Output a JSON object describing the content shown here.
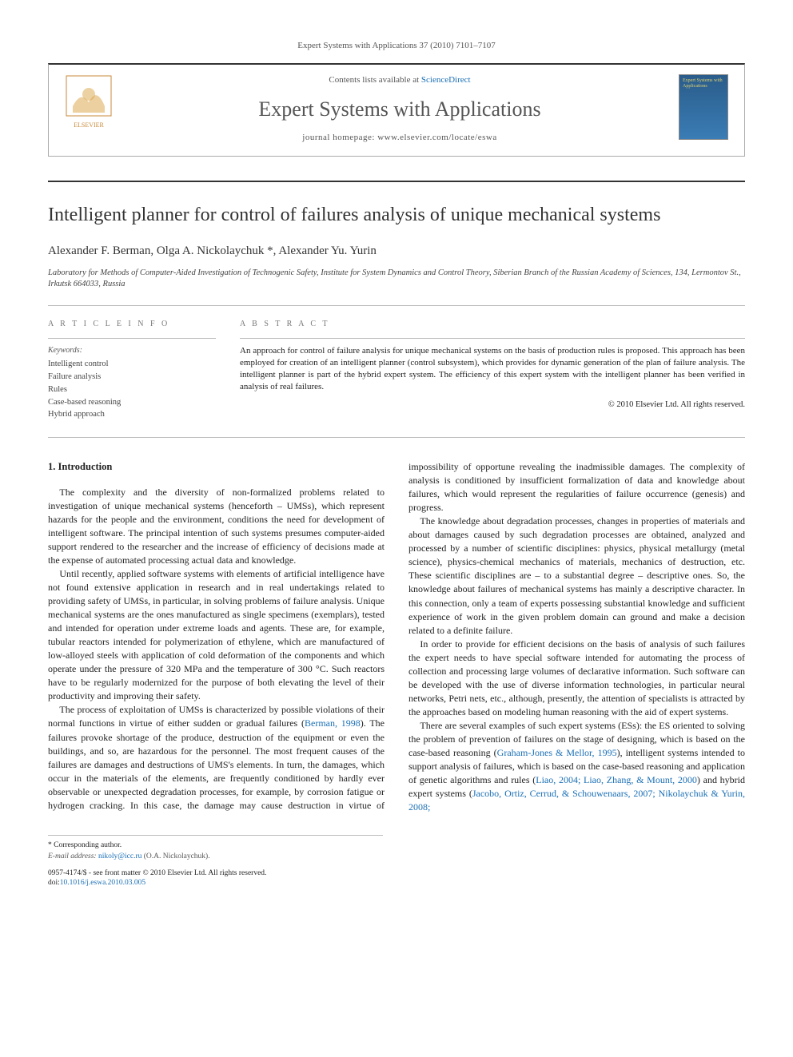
{
  "citation": "Expert Systems with Applications 37 (2010) 7101–7107",
  "header": {
    "contents_prefix": "Contents lists available at ",
    "contents_link": "ScienceDirect",
    "journal": "Expert Systems with Applications",
    "homepage_prefix": "journal homepage: ",
    "homepage": "www.elsevier.com/locate/eswa",
    "cover_title": "Expert Systems with Applications",
    "elsevier_label": "ELSEVIER"
  },
  "article": {
    "title": "Intelligent planner for control of failures analysis of unique mechanical systems",
    "authors": "Alexander F. Berman, Olga A. Nickolaychuk *, Alexander Yu. Yurin",
    "affiliation": "Laboratory for Methods of Computer-Aided Investigation of Technogenic Safety, Institute for System Dynamics and Control Theory, Siberian Branch of the Russian Academy of Sciences, 134, Lermontov St., Irkutsk 664033, Russia"
  },
  "info": {
    "heading": "A R T I C L E   I N F O",
    "keywords_label": "Keywords:",
    "keywords": [
      "Intelligent control",
      "Failure analysis",
      "Rules",
      "Case-based reasoning",
      "Hybrid approach"
    ]
  },
  "abstract": {
    "heading": "A B S T R A C T",
    "text": "An approach for control of failure analysis for unique mechanical systems on the basis of production rules is proposed. This approach has been employed for creation of an intelligent planner (control subsystem), which provides for dynamic generation of the plan of failure analysis. The intelligent planner is part of the hybrid expert system. The efficiency of this expert system with the intelligent planner has been verified in analysis of real failures.",
    "copyright": "© 2010 Elsevier Ltd. All rights reserved."
  },
  "body": {
    "section1_heading": "1. Introduction",
    "p1": "The complexity and the diversity of non-formalized problems related to investigation of unique mechanical systems (henceforth – UMSs), which represent hazards for the people and the environment, conditions the need for development of intelligent software. The principal intention of such systems presumes computer-aided support rendered to the researcher and the increase of efficiency of decisions made at the expense of automated processing actual data and knowledge.",
    "p2": "Until recently, applied software systems with elements of artificial intelligence have not found extensive application in research and in real undertakings related to providing safety of UMSs, in particular, in solving problems of failure analysis. Unique mechanical systems are the ones manufactured as single specimens (exemplars), tested and intended for operation under extreme loads and agents. These are, for example, tubular reactors intended for polymerization of ethylene, which are manufactured of low-alloyed steels with application of cold deformation of the components and which operate under the pressure of 320 MPa and the temperature of 300 °C. Such reactors have to be regularly modernized for the purpose of both elevating the level of their productivity and improving their safety.",
    "p3a": "The process of exploitation of UMSs is characterized by possible violations of their normal functions in virtue of either sudden or gradual failures (",
    "p3_cite": "Berman, 1998",
    "p3b": "). The failures provoke shortage of the produce, destruction of the equipment or even the buildings, and so, are hazardous for the personnel. The most frequent causes of the failures are damages and destructions of UMS's elements. In turn, the damages, which occur in the materials of the elements, are frequently conditioned by hardly ever observable or unexpected degradation processes, for example, by corrosion fatigue or hydrogen cracking. In this case, the damage may cause destruction in virtue of impossibility of opportune revealing the inadmissible damages. The complexity of analysis is conditioned by insufficient formalization of data and knowledge about failures, which would represent the regularities of failure occurrence (genesis) and progress.",
    "p4": "The knowledge about degradation processes, changes in properties of materials and about damages caused by such degradation processes are obtained, analyzed and processed by a number of scientific disciplines: physics, physical metallurgy (metal science), physics-chemical mechanics of materials, mechanics of destruction, etc. These scientific disciplines are – to a substantial degree – descriptive ones. So, the knowledge about failures of mechanical systems has mainly a descriptive character. In this connection, only a team of experts possessing substantial knowledge and sufficient experience of work in the given problem domain can ground and make a decision related to a definite failure.",
    "p5": "In order to provide for efficient decisions on the basis of analysis of such failures the expert needs to have special software intended for automating the process of collection and processing large volumes of declarative information. Such software can be developed with the use of diverse information technologies, in particular neural networks, Petri nets, etc., although, presently, the attention of specialists is attracted by the approaches based on modeling human reasoning with the aid of expert systems.",
    "p6a": "There are several examples of such expert systems (ESs): the ES oriented to solving the problem of prevention of failures on the stage of designing, which is based on the case-based reasoning (",
    "p6_cite1": "Graham-Jones & Mellor, 1995",
    "p6b": "), intelligent systems intended to support analysis of failures, which is based on the case-based reasoning and application of genetic algorithms and rules (",
    "p6_cite2": "Liao, 2004; Liao, Zhang, & Mount, 2000",
    "p6c": ") and hybrid expert systems (",
    "p6_cite3": "Jacobo, Ortiz, Cerrud, & Schouwenaars, 2007; Nikolaychuk & Yurin, 2008;",
    "p6d": ""
  },
  "footer": {
    "corr": "* Corresponding author.",
    "email_label": "E-mail address: ",
    "email": "nikoly@icc.ru",
    "email_person": " (O.A. Nickolaychuk).",
    "issn_line": "0957-4174/$ - see front matter © 2010 Elsevier Ltd. All rights reserved.",
    "doi_label": "doi:",
    "doi": "10.1016/j.eswa.2010.03.005"
  }
}
